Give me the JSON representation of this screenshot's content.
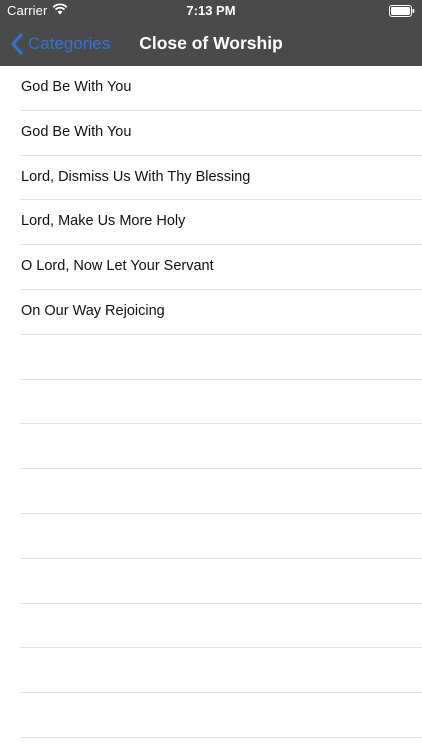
{
  "status_bar": {
    "carrier": "Carrier",
    "time": "7:13 PM",
    "wifi_icon": "wifi-icon",
    "battery_icon": "battery-icon"
  },
  "nav": {
    "back_label": "Categories",
    "title": "Close of Worship",
    "back_icon": "chevron-left-icon",
    "bar_color": "#4a4a4a",
    "accent_color": "#2f73d8"
  },
  "list": {
    "items": [
      "God Be With You",
      "God Be With You",
      "Lord, Dismiss Us With Thy Blessing",
      "Lord, Make Us More Holy",
      "O Lord, Now Let Your Servant",
      "On Our Way Rejoicing"
    ]
  }
}
